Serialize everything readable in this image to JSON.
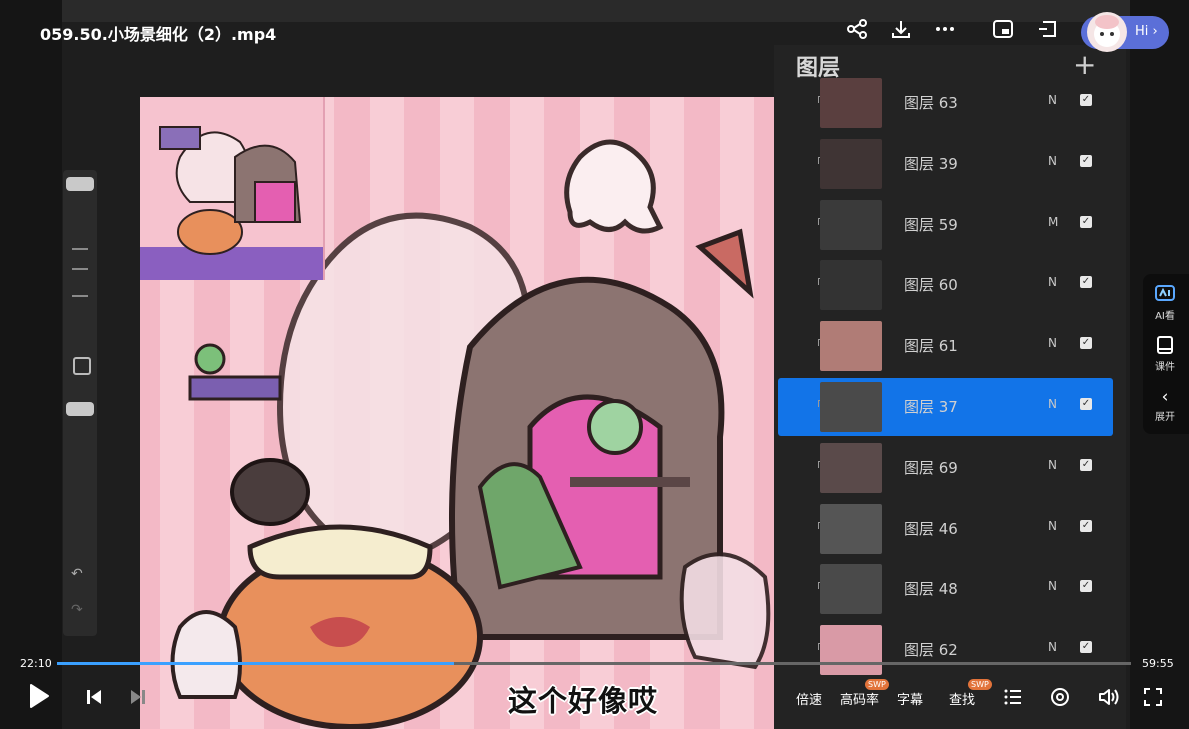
{
  "video": {
    "title": "059.50.小场景细化（2）.mp4",
    "subtitle": "这个好像哎"
  },
  "header_icons": [
    "share-icon",
    "download-icon",
    "more-icon",
    "picture-in-picture-icon",
    "projection-icon"
  ],
  "assistant": {
    "label": "Hi"
  },
  "side_panel": {
    "items": [
      {
        "icon": "ai-watch-icon",
        "label": "AI看"
      },
      {
        "icon": "courseware-icon",
        "label": "课件"
      },
      {
        "icon": "chevron-left-icon",
        "label": "展开"
      }
    ]
  },
  "procreate": {
    "layers_title": "图层",
    "add_symbol": "+",
    "layers": [
      {
        "name": "图层 63",
        "mode": "N",
        "visible": true,
        "active": false
      },
      {
        "name": "图层 39",
        "mode": "N",
        "visible": true,
        "active": false
      },
      {
        "name": "图层 59",
        "mode": "M",
        "visible": true,
        "active": false
      },
      {
        "name": "图层 60",
        "mode": "N",
        "visible": true,
        "active": false
      },
      {
        "name": "图层 61",
        "mode": "N",
        "visible": true,
        "active": false
      },
      {
        "name": "图层 37",
        "mode": "N",
        "visible": true,
        "active": true
      },
      {
        "name": "图层 69",
        "mode": "N",
        "visible": true,
        "active": false
      },
      {
        "name": "图层 46",
        "mode": "N",
        "visible": true,
        "active": false
      },
      {
        "name": "图层 48",
        "mode": "N",
        "visible": true,
        "active": false
      },
      {
        "name": "图层 62",
        "mode": "N",
        "visible": true,
        "active": false
      }
    ]
  },
  "playback": {
    "current_time": "22:10",
    "total_time": "59:55",
    "progress": 0.37,
    "speed_label": "倍速",
    "quality_label": "高码率",
    "quality_badge": "SWP",
    "caption_label": "字幕",
    "search_label": "查找",
    "search_badge": "SWP"
  },
  "colors": {
    "accent": "#3aa0ff",
    "layer_active": "#1274e8",
    "canvas_pink": "#f3b9c6",
    "assistant_blue": "#5b6fd8"
  }
}
